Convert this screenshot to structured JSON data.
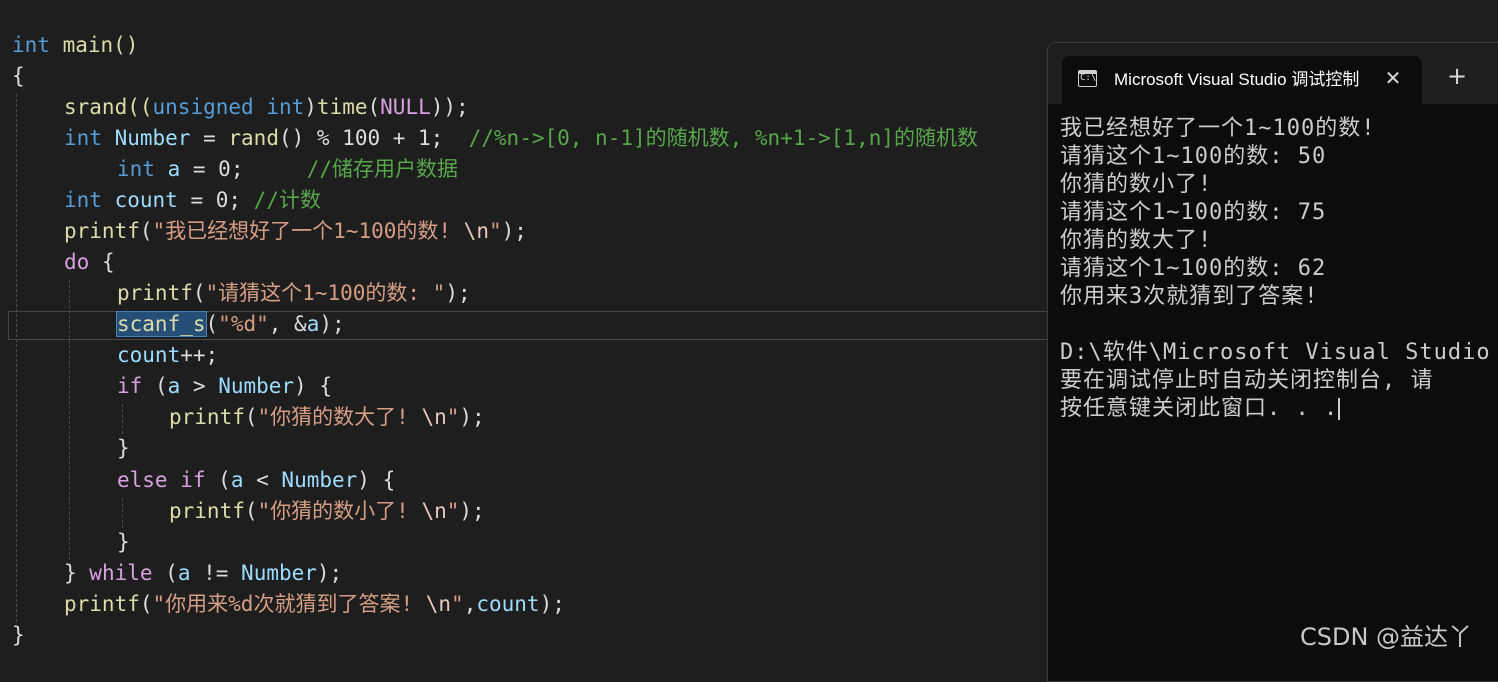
{
  "editor": {
    "lines": [
      {
        "t0": "int",
        "t1": " main()"
      },
      {
        "t0": "{"
      },
      {
        "t0": "srand((",
        "t1": "unsigned",
        "t2": " ",
        "t3": "int",
        "t4": ")",
        "t5": "time",
        "t6": "(",
        "t7": "NULL",
        "t8": "));"
      },
      {
        "t0": "int",
        "t1": " ",
        "t2": "Number",
        "t3": " = ",
        "t4": "rand",
        "t5": "() % 100 + 1;  ",
        "t6": "//%n->[0, n-1]的随机数, %n+1->[1,n]的随机数"
      },
      {
        "t0": "int",
        "t1": " ",
        "t2": "a",
        "t3": " = 0;     ",
        "t4": "//储存用户数据"
      },
      {
        "t0": "int",
        "t1": " ",
        "t2": "count",
        "t3": " = 0; ",
        "t4": "//计数"
      },
      {
        "t0": "printf",
        "t1": "(",
        "t2": "\"我已经想好了一个1~100的数! ",
        "t3": "\\n",
        "t4": "\"",
        "t5": ");"
      },
      {
        "t0": "do",
        "t1": " {"
      },
      {
        "t0": "printf",
        "t1": "(",
        "t2": "\"请猜这个1~100的数: \"",
        "t3": ");"
      },
      {
        "t0": "scanf_s",
        "t1": "(",
        "t2": "\"%d\"",
        "t3": ", &",
        "t4": "a",
        "t5": ");"
      },
      {
        "t0": "count",
        "t1": "++;"
      },
      {
        "t0": "if",
        "t1": " (",
        "t2": "a",
        "t3": " > ",
        "t4": "Number",
        "t5": ") {"
      },
      {
        "t0": "printf",
        "t1": "(",
        "t2": "\"你猜的数大了! ",
        "t3": "\\n",
        "t4": "\"",
        "t5": ");"
      },
      {
        "t0": "}"
      },
      {
        "t0": "else",
        "t1": " ",
        "t2": "if",
        "t3": " (",
        "t4": "a",
        "t5": " < ",
        "t6": "Number",
        "t7": ") {"
      },
      {
        "t0": "printf",
        "t1": "(",
        "t2": "\"你猜的数小了! ",
        "t3": "\\n",
        "t4": "\"",
        "t5": ");"
      },
      {
        "t0": "}"
      },
      {
        "t0": "} ",
        "t1": "while",
        "t2": " (",
        "t3": "a",
        "t4": " != ",
        "t5": "Number",
        "t6": ");"
      },
      {
        "t0": "printf",
        "t1": "(",
        "t2": "\"你用来%d次就猜到了答案! ",
        "t3": "\\n",
        "t4": "\"",
        "t5": ",",
        "t6": "count",
        "t7": ");"
      },
      {
        "t0": "}"
      }
    ]
  },
  "console": {
    "tab_title": "Microsoft Visual Studio 调试控制台",
    "tab_close": "✕",
    "new_tab": "+",
    "dropdown": "⌄",
    "icon_glyph": "C:\\",
    "output": [
      "我已经想好了一个1~100的数!",
      "请猜这个1~100的数: 50",
      "你猜的数小了!",
      "请猜这个1~100的数: 75",
      "你猜的数大了!",
      "请猜这个1~100的数: 62",
      "你用来3次就猜到了答案!",
      "",
      "D:\\软件\\Microsoft Visual Studio",
      "要在调试停止时自动关闭控制台, 请",
      "按任意键关闭此窗口. . ."
    ]
  },
  "watermark": "CSDN @益达丫",
  "colors": {
    "editor_bg": "#1e1e1e",
    "keyword": "#569cd6",
    "control_keyword": "#d8a0df",
    "function": "#dcdcaa",
    "variable": "#9cdcfe",
    "string": "#d69d85",
    "comment": "#57a64a",
    "console_bg": "#0c0c0c"
  }
}
